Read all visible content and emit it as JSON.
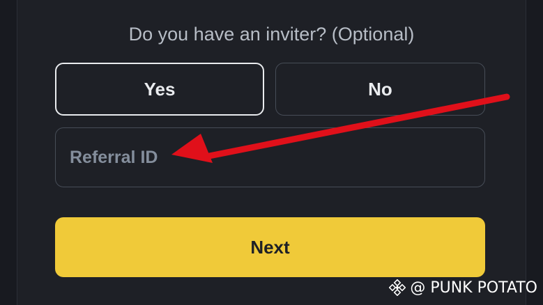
{
  "form": {
    "question": "Do you have an inviter? (Optional)",
    "yes_label": "Yes",
    "no_label": "No",
    "referral_placeholder": "Referral ID",
    "referral_value": "",
    "next_label": "Next"
  },
  "watermark": {
    "text": "@ PUNK POTATO"
  },
  "colors": {
    "background": "#1e2026",
    "accent": "#f0ca39",
    "arrow": "#e0101a"
  },
  "icons": {
    "watermark_logo": "binance-diamond-icon",
    "annotation": "red-arrow-icon"
  }
}
